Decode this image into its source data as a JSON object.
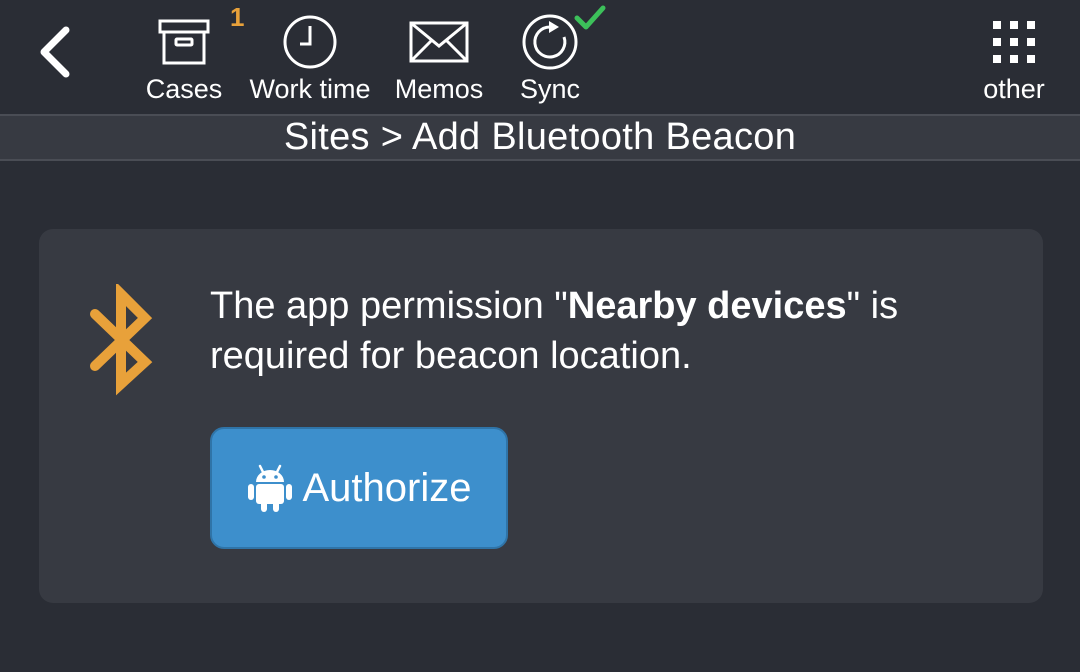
{
  "toolbar": {
    "back_icon": "chevron-left-icon",
    "items": [
      {
        "label": "Cases",
        "icon": "archive-box-icon",
        "badge": "1"
      },
      {
        "label": "Work time",
        "icon": "clock-icon"
      },
      {
        "label": "Memos",
        "icon": "envelope-icon"
      },
      {
        "label": "Sync",
        "icon": "sync-icon",
        "status": "check-icon"
      }
    ],
    "other": {
      "label": "other",
      "icon": "grid-dots-icon"
    }
  },
  "breadcrumb": {
    "text": "Sites > Add Bluetooth Beacon"
  },
  "card": {
    "icon": "bluetooth-icon",
    "message_before": "The app permission \"",
    "message_bold": "Nearby devices",
    "message_after": "\" is required for beacon location.",
    "button": {
      "label": "Authorize",
      "icon": "android-icon"
    }
  },
  "colors": {
    "background": "#2a2d35",
    "card": "#373a42",
    "accent_orange": "#e8a13a",
    "button_blue": "#3d8fcc",
    "check_green": "#3cc05a"
  }
}
